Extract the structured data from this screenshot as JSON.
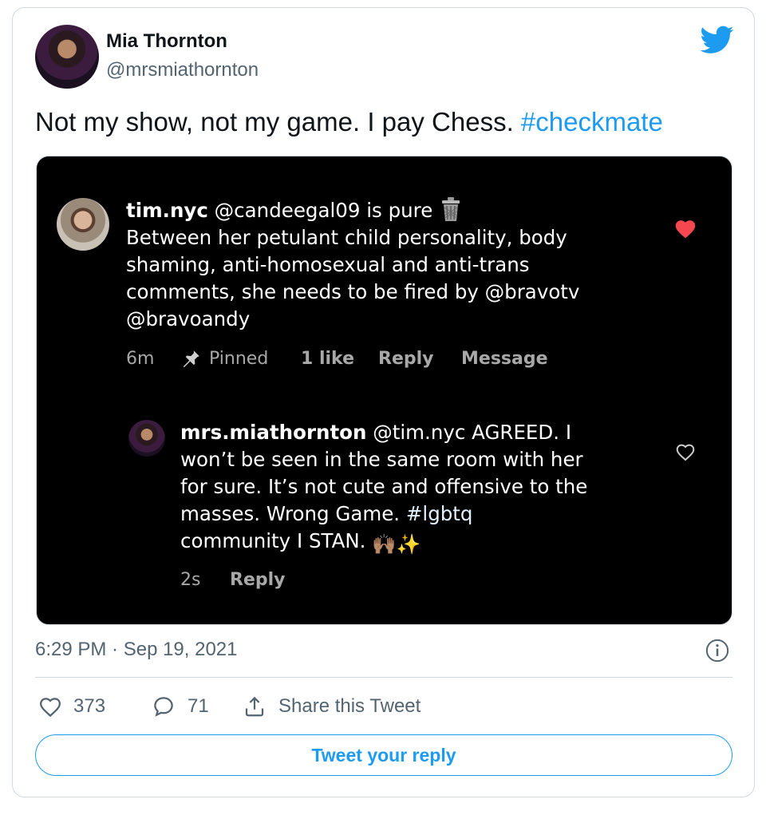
{
  "author": {
    "name": "Mia Thornton",
    "handle": "@mrsmiathornton"
  },
  "tweet": {
    "text": "Not my show,  not my game.  I pay Chess. ",
    "hashtag": "#checkmate",
    "timestamp": "6:29 PM · Sep 19, 2021"
  },
  "screenshot": {
    "comment1": {
      "username": "tim.nyc",
      "lines": [
        " @candeegal09 is pure",
        "Between her petulant child personality, body",
        "shaming, anti-homosexual and anti-trans",
        "comments, she needs to be fired by @bravotv",
        "@bravoandy"
      ],
      "time": "6m",
      "pinned": "Pinned",
      "likes": "1 like",
      "reply": "Reply",
      "message": "Message",
      "liked": true
    },
    "comment2": {
      "username": "mrs.miathornton",
      "lines": [
        " @tim.nyc AGREED.  I",
        "won’t be seen in the same room with her",
        "for sure.  It’s not cute and offensive to the",
        "masses.  Wrong Game.  ",
        "community I STAN. "
      ],
      "hashtag": "#lgbtq",
      "emoji": "🙌🏽✨",
      "time": "2s",
      "reply": "Reply"
    }
  },
  "stats": {
    "likes": "373",
    "replies": "71",
    "share_label": "Share this Tweet"
  },
  "reply_button": "Tweet your reply",
  "colors": {
    "accent": "#1d9bf0",
    "text": "#0f1419",
    "secondary": "#536471",
    "liked_heart": "#f4474f"
  },
  "icons": [
    "twitter-bird-icon",
    "pin-icon",
    "trash-icon",
    "heart-icon",
    "comment-icon",
    "share-icon",
    "info-icon"
  ]
}
